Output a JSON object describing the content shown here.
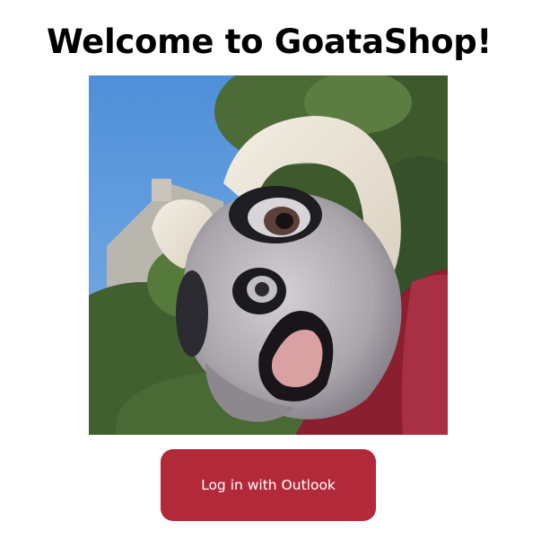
{
  "page": {
    "title": "Welcome to GoataShop!"
  },
  "hero": {
    "image_subject": "goat-mascot-photo"
  },
  "login": {
    "button_label": "Log in with Outlook"
  },
  "colors": {
    "button_background": "#b22a3a",
    "button_text": "#ffffff",
    "title_text": "#000000",
    "page_background": "#ffffff"
  }
}
